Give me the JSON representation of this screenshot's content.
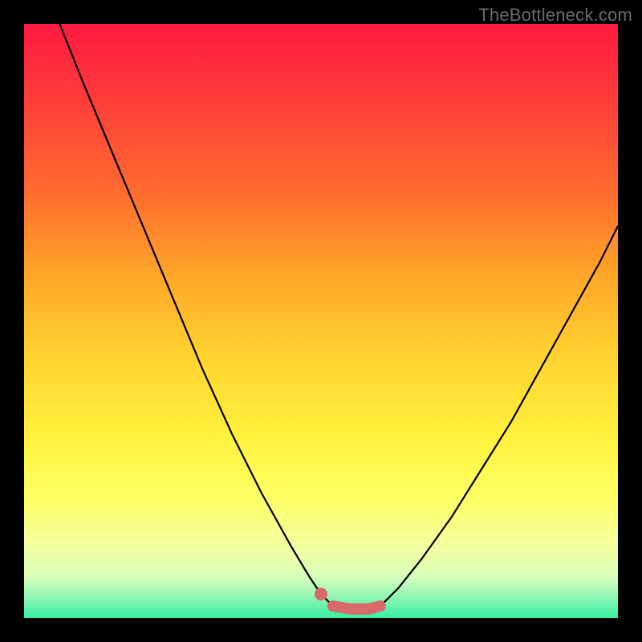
{
  "watermark": {
    "text": "TheBottleneck.com"
  },
  "colors": {
    "curve_stroke": "#000000",
    "marker_stroke": "#d86a6a",
    "marker_fill": "#d86a6a"
  },
  "chart_data": {
    "type": "line",
    "title": "",
    "xlabel": "",
    "ylabel": "",
    "xlim": [
      0,
      100
    ],
    "ylim": [
      0,
      100
    ],
    "grid": false,
    "legend": false,
    "series": [
      {
        "name": "left-curve",
        "x": [
          6,
          10,
          15,
          20,
          25,
          30,
          35,
          40,
          45,
          48,
          50,
          52
        ],
        "y": [
          100,
          90,
          78,
          66,
          54,
          42,
          31,
          21,
          12,
          7,
          4,
          2
        ]
      },
      {
        "name": "right-curve",
        "x": [
          60,
          63,
          67,
          72,
          77,
          82,
          87,
          92,
          97,
          100
        ],
        "y": [
          2,
          5,
          10,
          17,
          25,
          33,
          42,
          51,
          60,
          66
        ]
      },
      {
        "name": "flat-bottom-marker",
        "x": [
          52,
          55,
          58,
          60
        ],
        "y": [
          2,
          1.5,
          1.5,
          2
        ]
      }
    ],
    "annotations": [
      {
        "type": "dot",
        "x": 50,
        "y": 4
      }
    ]
  }
}
